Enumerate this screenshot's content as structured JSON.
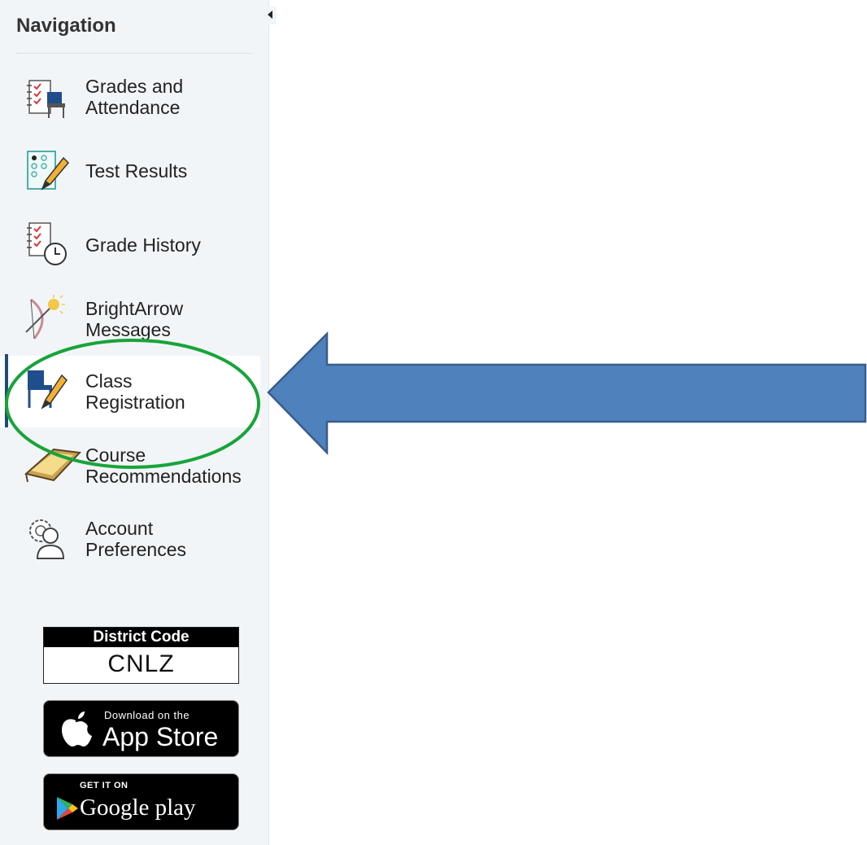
{
  "sidebar": {
    "title": "Navigation",
    "items": [
      {
        "label": "Grades and\nAttendance",
        "icon": "grades-attendance-icon"
      },
      {
        "label": "Test Results",
        "icon": "test-results-icon"
      },
      {
        "label": "Grade History",
        "icon": "grade-history-icon"
      },
      {
        "label": "BrightArrow\nMessages",
        "icon": "brightarrow-icon"
      },
      {
        "label": "Class\nRegistration",
        "icon": "class-registration-icon",
        "active": true
      },
      {
        "label": "Course\nRecommendations",
        "icon": "course-recommendations-icon"
      },
      {
        "label": "Account\nPreferences",
        "icon": "account-preferences-icon"
      }
    ]
  },
  "district": {
    "heading": "District Code",
    "code": "CNLZ"
  },
  "app_store": {
    "small": "Download on the",
    "big": "App Store"
  },
  "google_play": {
    "small": "GET IT ON",
    "big": "Google play"
  },
  "colors": {
    "arrow": "#4f81bd",
    "arrow_border": "#385d8a",
    "highlight_circle": "#18a43a",
    "active_bar": "#1f4c73"
  }
}
